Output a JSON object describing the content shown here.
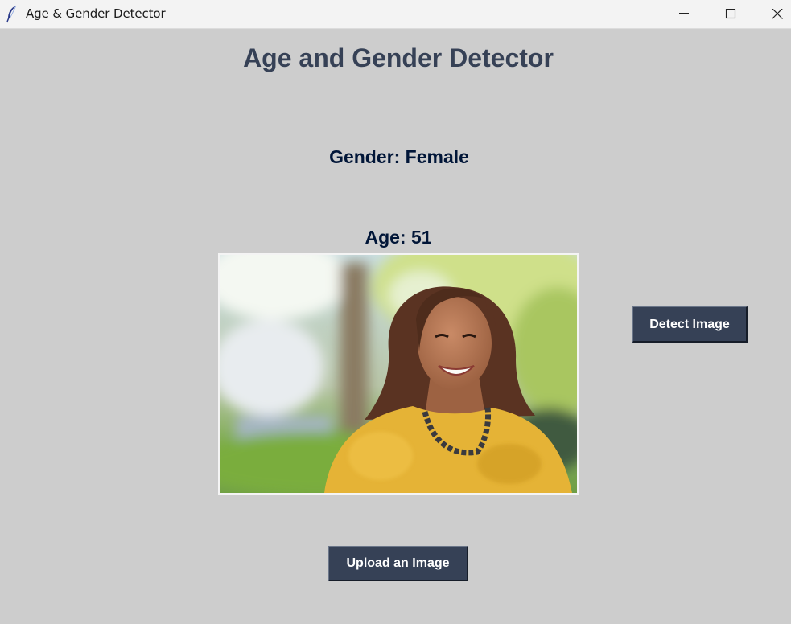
{
  "window": {
    "title": "Age & Gender Detector",
    "controls": {
      "minimize": "minimize-icon",
      "maximize": "maximize-icon",
      "close": "close-icon"
    },
    "app_icon": "feather-icon"
  },
  "main": {
    "heading": "Age and Gender Detector",
    "gender_label": "Gender: Female",
    "age_label": "Age: 51",
    "detect_button": "Detect Image",
    "upload_button": "Upload an Image"
  },
  "colors": {
    "background": "#cdcdcd",
    "heading": "#364156",
    "label": "#011638",
    "button": "#364156",
    "button_text": "#ffffff"
  }
}
